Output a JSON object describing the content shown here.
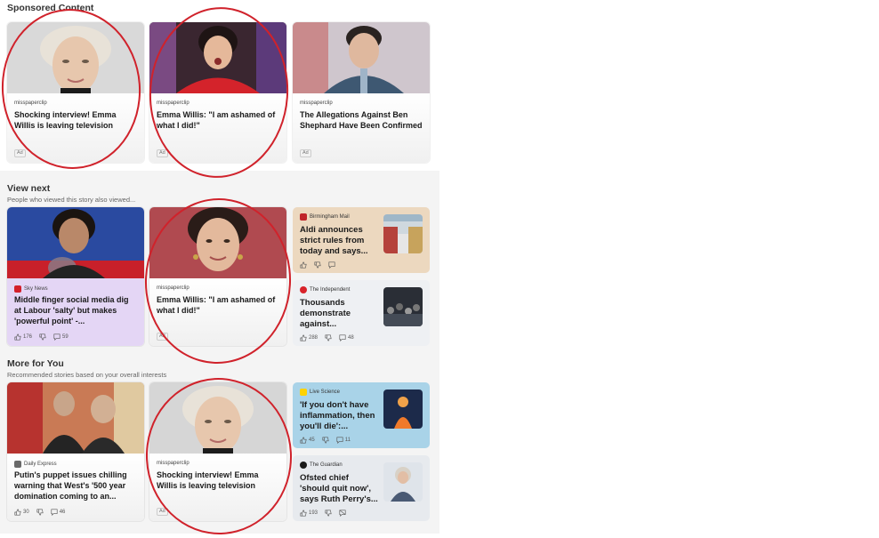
{
  "sponsored": {
    "title": "Sponsored Content",
    "cards": [
      {
        "source": "misspaperclip",
        "headline": "Shocking interview! Emma Willis is leaving television",
        "ad": "Ad"
      },
      {
        "source": "misspaperclip",
        "headline": "Emma Willis: \"I am ashamed of what I did!\"",
        "ad": "Ad"
      },
      {
        "source": "misspaperclip",
        "headline": "The Allegations Against Ben Shephard Have Been Confirmed",
        "ad": "Ad"
      }
    ]
  },
  "view_next": {
    "title": "View next",
    "subtitle": "People who viewed this story also viewed...",
    "card1": {
      "source": "Sky News",
      "headline": "Middle finger social media dig at Labour 'salty' but makes 'powerful point' -...",
      "likes": "176",
      "comments": "59"
    },
    "card2": {
      "source": "misspaperclip",
      "headline": "Emma Willis: \"I am ashamed of what I did!\"",
      "ad": "Ad"
    },
    "side": [
      {
        "source": "Birmingham Mail",
        "headline": "Aldi announces strict rules from today and says...",
        "likes": "",
        "comments": ""
      },
      {
        "source": "The Independent",
        "headline": "Thousands demonstrate against...",
        "likes": "288",
        "comments": "48"
      }
    ]
  },
  "more_for_you": {
    "title": "More for You",
    "subtitle": "Recommended stories based on your overall interests",
    "card1": {
      "source": "Daily Express",
      "headline": "Putin's puppet issues chilling warning that West's '500 year domination coming to an...",
      "likes": "30",
      "comments": "46"
    },
    "card2": {
      "source": "misspaperclip",
      "headline": "Shocking interview! Emma Willis is leaving television",
      "ad": "Ad"
    },
    "side": [
      {
        "source": "Live Science",
        "headline": "'If you don't have inflammation, then you'll die':...",
        "likes": "45",
        "comments": "11"
      },
      {
        "source": "The Guardian",
        "headline": "Ofsted chief 'should quit now', says Ruth Perry's...",
        "likes": "193",
        "comments": ""
      }
    ]
  },
  "colors": {
    "annotation": "#d0222b",
    "sky_purple": "#e4d6f5",
    "bham_tan": "#ecd8bf",
    "indie_gray": "#eef0f3",
    "livesci_blue": "#a9d3e8",
    "guardian_gray": "#e7eaee"
  }
}
